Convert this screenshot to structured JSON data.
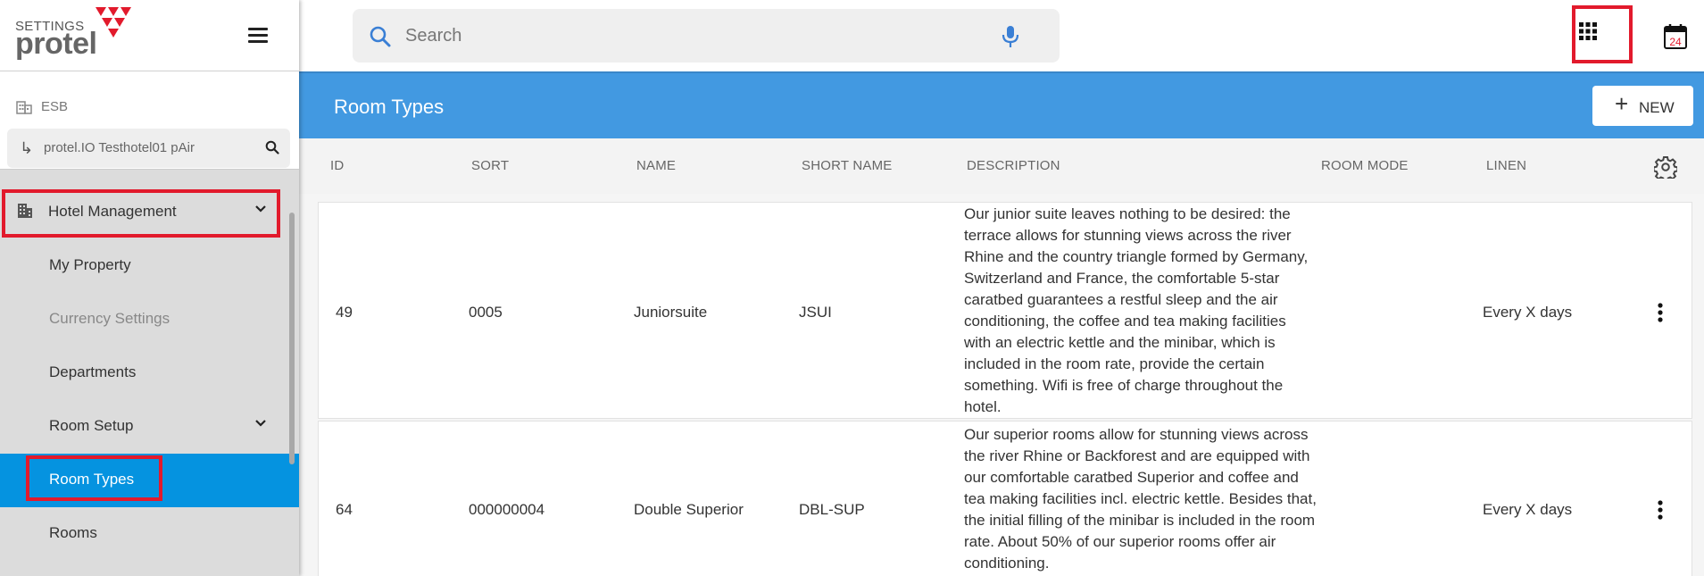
{
  "brand": {
    "settings": "SETTINGS",
    "name": "protel"
  },
  "sidebar": {
    "org": "ESB",
    "hotel": "protel.IO Testhotel01 pAir",
    "items": [
      {
        "label": "Hotel Management"
      },
      {
        "label": "My Property"
      },
      {
        "label": "Currency Settings"
      },
      {
        "label": "Departments"
      },
      {
        "label": "Room Setup"
      },
      {
        "label": "Room Types"
      },
      {
        "label": "Rooms"
      }
    ]
  },
  "search": {
    "placeholder": "Search"
  },
  "calendar": {
    "day": "24"
  },
  "page": {
    "title": "Room Types",
    "new_label": "NEW"
  },
  "columns": [
    "ID",
    "SORT",
    "NAME",
    "SHORT NAME",
    "DESCRIPTION",
    "ROOM MODE",
    "LINEN"
  ],
  "rows": [
    {
      "id": "49",
      "sort": "0005",
      "name": "Juniorsuite",
      "short": "JSUI",
      "description": "Our junior suite leaves nothing to be desired: the terrace allows for stunning views across the river Rhine and the country triangle formed by Germany, Switzerland and France, the comfortable 5-star caratbed guarantees a restful sleep and the air conditioning, the coffee and tea making facilities with an electric kettle and the minibar, which is included in the room rate, provide the certain something. Wifi is free of charge throughout the hotel.",
      "room_mode": "",
      "linen": "Every X days"
    },
    {
      "id": "64",
      "sort": "000000004",
      "name": "Double Superior",
      "short": "DBL-SUP",
      "description": "Our superior rooms allow for stunning views across the river Rhine or Backforest and are equipped with our comfortable caratbed Superior and coffee and tea making facilities incl. electric kettle. Besides that, the initial filling of the minibar is included in the room rate. About 50% of our superior rooms offer air conditioning.",
      "room_mode": "",
      "linen": "Every X days"
    }
  ],
  "colors": {
    "accent": "#4299e1",
    "active": "#0593e0",
    "highlight": "#e21a2c",
    "logo": "#e21a2c"
  }
}
